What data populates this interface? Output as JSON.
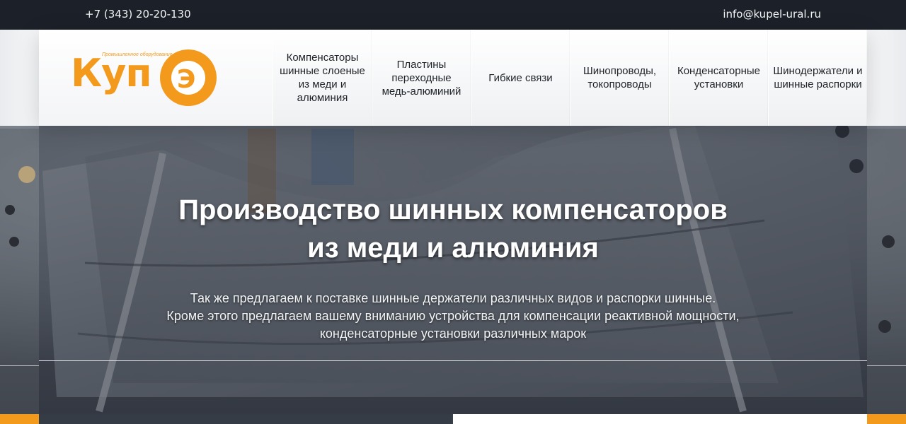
{
  "topbar": {
    "phone": "+7 (343) 20-20-130",
    "email": "info@kupel-ural.ru"
  },
  "logo": {
    "text": "КупЭл",
    "tagline": "Промышленное оборудование"
  },
  "nav": {
    "items": [
      {
        "label": "Компенсаторы шинные слоеные из меди и алюминия"
      },
      {
        "label": "Пластины переходные медь-алюминий"
      },
      {
        "label": "Гибкие связи"
      },
      {
        "label": "Шинопроводы, токопроводы"
      },
      {
        "label": "Конденсаторные установки"
      },
      {
        "label": "Шинодержатели и шинные распорки"
      }
    ]
  },
  "hero": {
    "title_line1": "Производство шинных компенсаторов",
    "title_line2": "из меди и алюминия",
    "text_line1": "Так же предлагаем к поставке шинные держатели различных видов и распорки шинные.",
    "text_line2": "Кроме этого предлагаем вашему вниманию устройства для компенсации реактивной мощности,",
    "text_line3": "конденсаторные установки различных марок"
  },
  "colors": {
    "accent": "#f39a1d",
    "topbar": "#1c2129",
    "text_dark": "#1f2328"
  }
}
